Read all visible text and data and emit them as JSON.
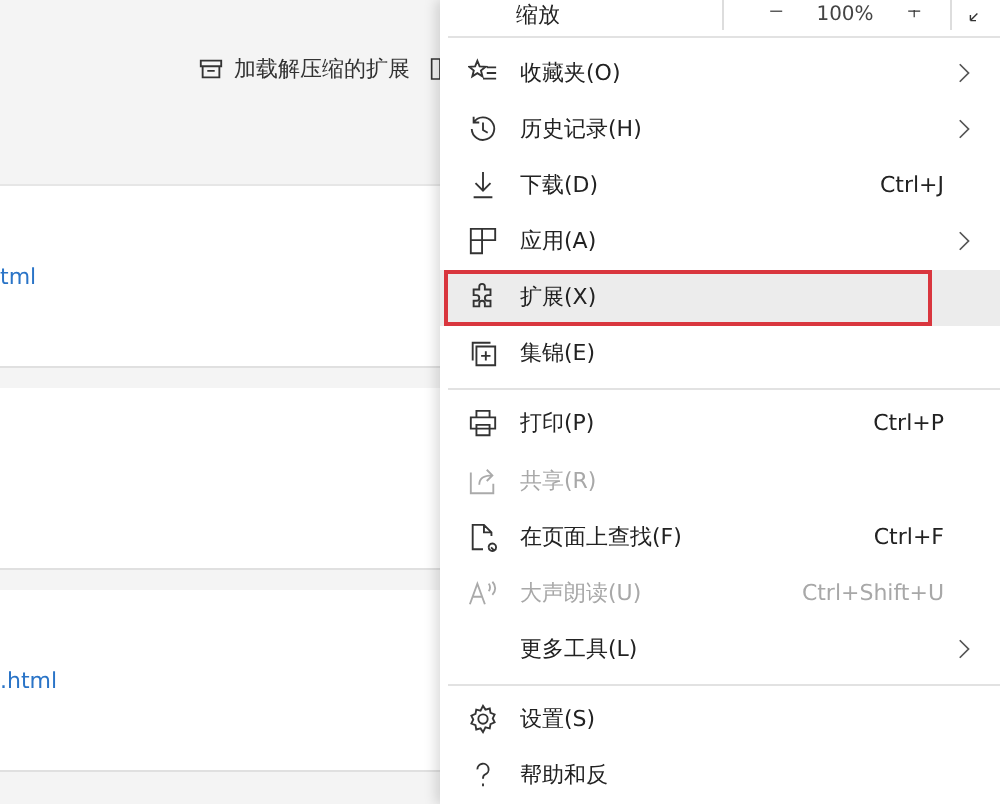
{
  "page": {
    "load_unpacked_button": "加载解压缩的扩展",
    "cards": [
      {
        "kind": "link",
        "link": "tml"
      },
      {
        "kind": "blank"
      },
      {
        "kind": "link",
        "link": ".html"
      }
    ]
  },
  "menu": {
    "zoom_row": {
      "label": "缩放",
      "value": "100%"
    },
    "groups": [
      [
        {
          "label": "收藏夹(O)",
          "submenu": true,
          "disabled": false,
          "selected": false,
          "outlined": false
        },
        {
          "label": "历史记录(H)",
          "submenu": true,
          "disabled": false,
          "selected": false,
          "outlined": false
        },
        {
          "label": "下载(D)",
          "shortcut": "Ctrl+J",
          "submenu": false,
          "disabled": false,
          "selected": false,
          "outlined": false
        },
        {
          "label": "应用(A)",
          "submenu": true,
          "disabled": false,
          "selected": false,
          "outlined": false
        },
        {
          "label": "扩展(X)",
          "submenu": false,
          "disabled": false,
          "selected": true,
          "outlined": true
        },
        {
          "label": "集锦(E)",
          "submenu": false,
          "disabled": false,
          "selected": false,
          "outlined": false
        }
      ],
      [
        {
          "label": "打印(P)",
          "shortcut": "Ctrl+P",
          "submenu": false,
          "disabled": false,
          "selected": false,
          "outlined": false
        },
        {
          "label": "共享(R)",
          "submenu": false,
          "disabled": true,
          "selected": false,
          "outlined": false
        },
        {
          "label": "在页面上查找(F)",
          "shortcut": "Ctrl+F",
          "submenu": false,
          "disabled": false,
          "selected": false,
          "outlined": false
        },
        {
          "label": "大声朗读(U)",
          "shortcut": "Ctrl+Shift+U",
          "submenu": false,
          "disabled": true,
          "selected": false,
          "outlined": false
        },
        {
          "label": "更多工具(L)",
          "submenu": true,
          "disabled": false,
          "selected": false,
          "outlined": false
        }
      ],
      [
        {
          "label": "设置(S)",
          "submenu": false,
          "disabled": false,
          "selected": false,
          "outlined": false
        },
        {
          "label": "帮助和反",
          "submenu": false,
          "disabled": false,
          "selected": false,
          "outlined": false
        }
      ]
    ]
  }
}
